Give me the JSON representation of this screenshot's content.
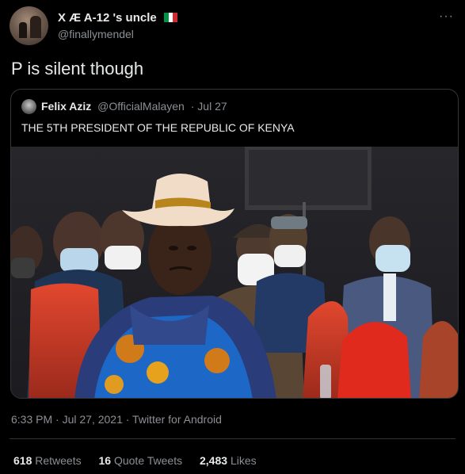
{
  "author": {
    "display_name": "X Æ A-12 's uncle",
    "handle": "@finallymendel",
    "more_icon": "more-dots-icon",
    "flag_colors": [
      "#009246",
      "#ffffff",
      "#ce2b37"
    ]
  },
  "tweet": {
    "text": "P is silent though"
  },
  "quoted": {
    "display_name": "Felix Aziz",
    "handle": "@OfficialMalayen",
    "date": "· Jul 27",
    "text": "THE 5TH PRESIDENT OF THE REPUBLIC OF KENYA"
  },
  "footer": {
    "timestamp": "6:33 PM · Jul 27, 2021 · Twitter for Android"
  },
  "stats": {
    "retweets_count": "618",
    "retweets_label": "Retweets",
    "quotes_count": "16",
    "quotes_label": "Quote Tweets",
    "likes_count": "2,483",
    "likes_label": "Likes"
  },
  "colors": {
    "background": "#000000",
    "primary_text": "#e7e9ea",
    "secondary_text": "#8b8f94",
    "border": "#333639"
  }
}
